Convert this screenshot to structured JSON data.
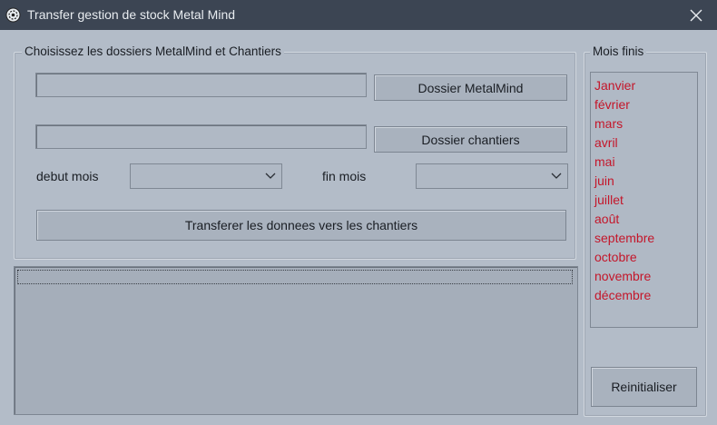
{
  "window": {
    "title": "Transfer gestion de stock Metal Mind"
  },
  "folders_group": {
    "title": "Choisissez les dossiers MetalMind et Chantiers",
    "metalmind_path": "",
    "metalmind_button": "Dossier MetalMind",
    "chantiers_path": "",
    "chantiers_button": "Dossier chantiers",
    "debut_label": "debut mois",
    "debut_value": "",
    "fin_label": "fin mois",
    "fin_value": "",
    "transfer_button": "Transferer les donnees vers les chantiers"
  },
  "months_group": {
    "title": "Mois finis",
    "months": [
      "Janvier",
      "février",
      "mars",
      "avril",
      "mai",
      "juin",
      "juillet",
      "août",
      "septembre",
      "octobre",
      "novembre",
      "décembre"
    ],
    "month_color": "#c4162a",
    "reset_button": "Reinitialiser"
  },
  "colors": {
    "titlebar": "#3c4553",
    "window_bg": "#b3bcc8"
  }
}
